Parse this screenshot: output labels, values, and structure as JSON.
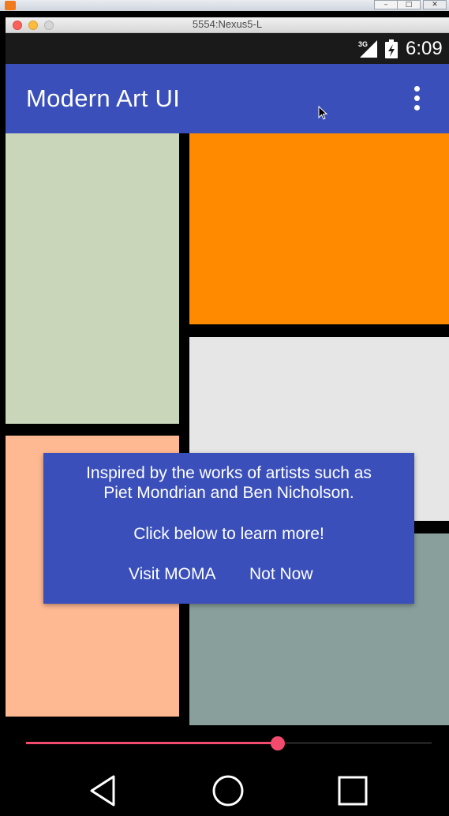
{
  "window": {
    "title": "5554:Nexus5-L"
  },
  "status_bar": {
    "network": "3G",
    "time": "6:09"
  },
  "app_bar": {
    "title": "Modern Art UI",
    "menu_icon": "overflow-menu-icon"
  },
  "art_blocks": [
    {
      "name": "sage",
      "color": "#cad6ba"
    },
    {
      "name": "orange",
      "color": "#ff8a00"
    },
    {
      "name": "light-gray",
      "color": "#e6e6e6"
    },
    {
      "name": "peach",
      "color": "#ffb992"
    },
    {
      "name": "gray-teal",
      "color": "#889f9b"
    }
  ],
  "dialog": {
    "line1": "Inspired by the works of artists such as",
    "line2": "Piet Mondrian and Ben Nicholson.",
    "line3": "Click below to learn more!",
    "positive_button": "Visit MOMA",
    "negative_button": "Not Now"
  },
  "slider": {
    "value_fraction": 0.62,
    "accent_color": "#f34b6e"
  },
  "nav_bar": {
    "icons": [
      "back-icon",
      "home-icon",
      "recents-icon"
    ]
  },
  "colors": {
    "primary": "#3a4fba",
    "accent": "#f34b6e"
  }
}
